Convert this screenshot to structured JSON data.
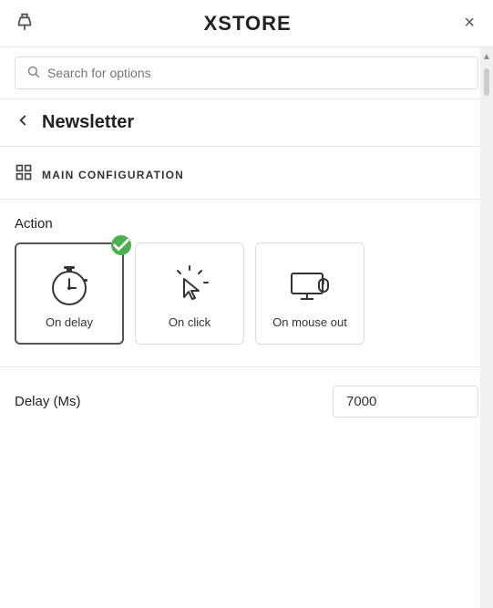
{
  "header": {
    "logo": "XSTORE",
    "close_label": "×",
    "pin_icon": "📌"
  },
  "search": {
    "placeholder": "Search for options",
    "value": ""
  },
  "nav": {
    "back_label": "‹",
    "title": "Newsletter"
  },
  "section": {
    "icon": "⊞",
    "title": "MAIN CONFIGURATION"
  },
  "action": {
    "label": "Action",
    "cards": [
      {
        "id": "on-delay",
        "label": "On delay",
        "selected": true
      },
      {
        "id": "on-click",
        "label": "On click",
        "selected": false
      },
      {
        "id": "on-mouse-out",
        "label": "On mouse out",
        "selected": false
      }
    ]
  },
  "delay": {
    "label": "Delay (Ms)",
    "value": "7000"
  }
}
